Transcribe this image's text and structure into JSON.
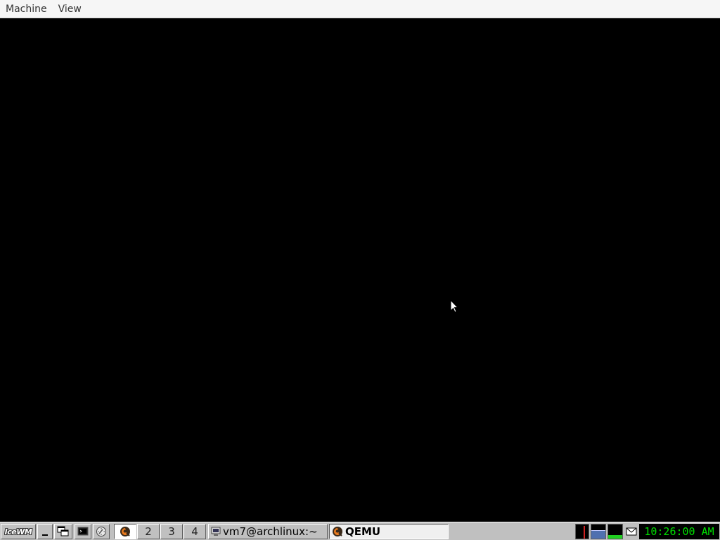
{
  "menubar": {
    "items": [
      {
        "label": "Machine"
      },
      {
        "label": "View"
      }
    ]
  },
  "taskbar": {
    "start": {
      "logo_text": "IceWM",
      "icon": "icewm-logo-icon"
    },
    "quick_launch": [
      {
        "name": "show-desktop",
        "icon": "minimize-icon"
      },
      {
        "name": "window-list",
        "icon": "windows-icon"
      },
      {
        "name": "terminal",
        "icon": "terminal-icon"
      },
      {
        "name": "browser",
        "icon": "globe-icon"
      }
    ],
    "workspaces": [
      {
        "label": "",
        "icon": "qemu-icon",
        "active": true
      },
      {
        "label": "2"
      },
      {
        "label": "3"
      },
      {
        "label": "4"
      }
    ],
    "tasks": [
      {
        "label": "vm7@archlinux:~",
        "icon": "terminal-icon",
        "active": false
      },
      {
        "label": "QEMU",
        "icon": "qemu-icon",
        "active": true
      }
    ],
    "tray": {
      "cpu_monitor": "cpu-monitor-icon",
      "net_monitor": "network-monitor-icon",
      "mem_monitor": "memory-monitor-icon",
      "mail": "mail-icon"
    },
    "clock": "10:26:00 AM"
  },
  "colors": {
    "menubar_bg": "#f6f6f6",
    "taskbar_bg": "#c0c0c0",
    "clock_fg": "#00e000",
    "guest_bg": "#000000"
  }
}
